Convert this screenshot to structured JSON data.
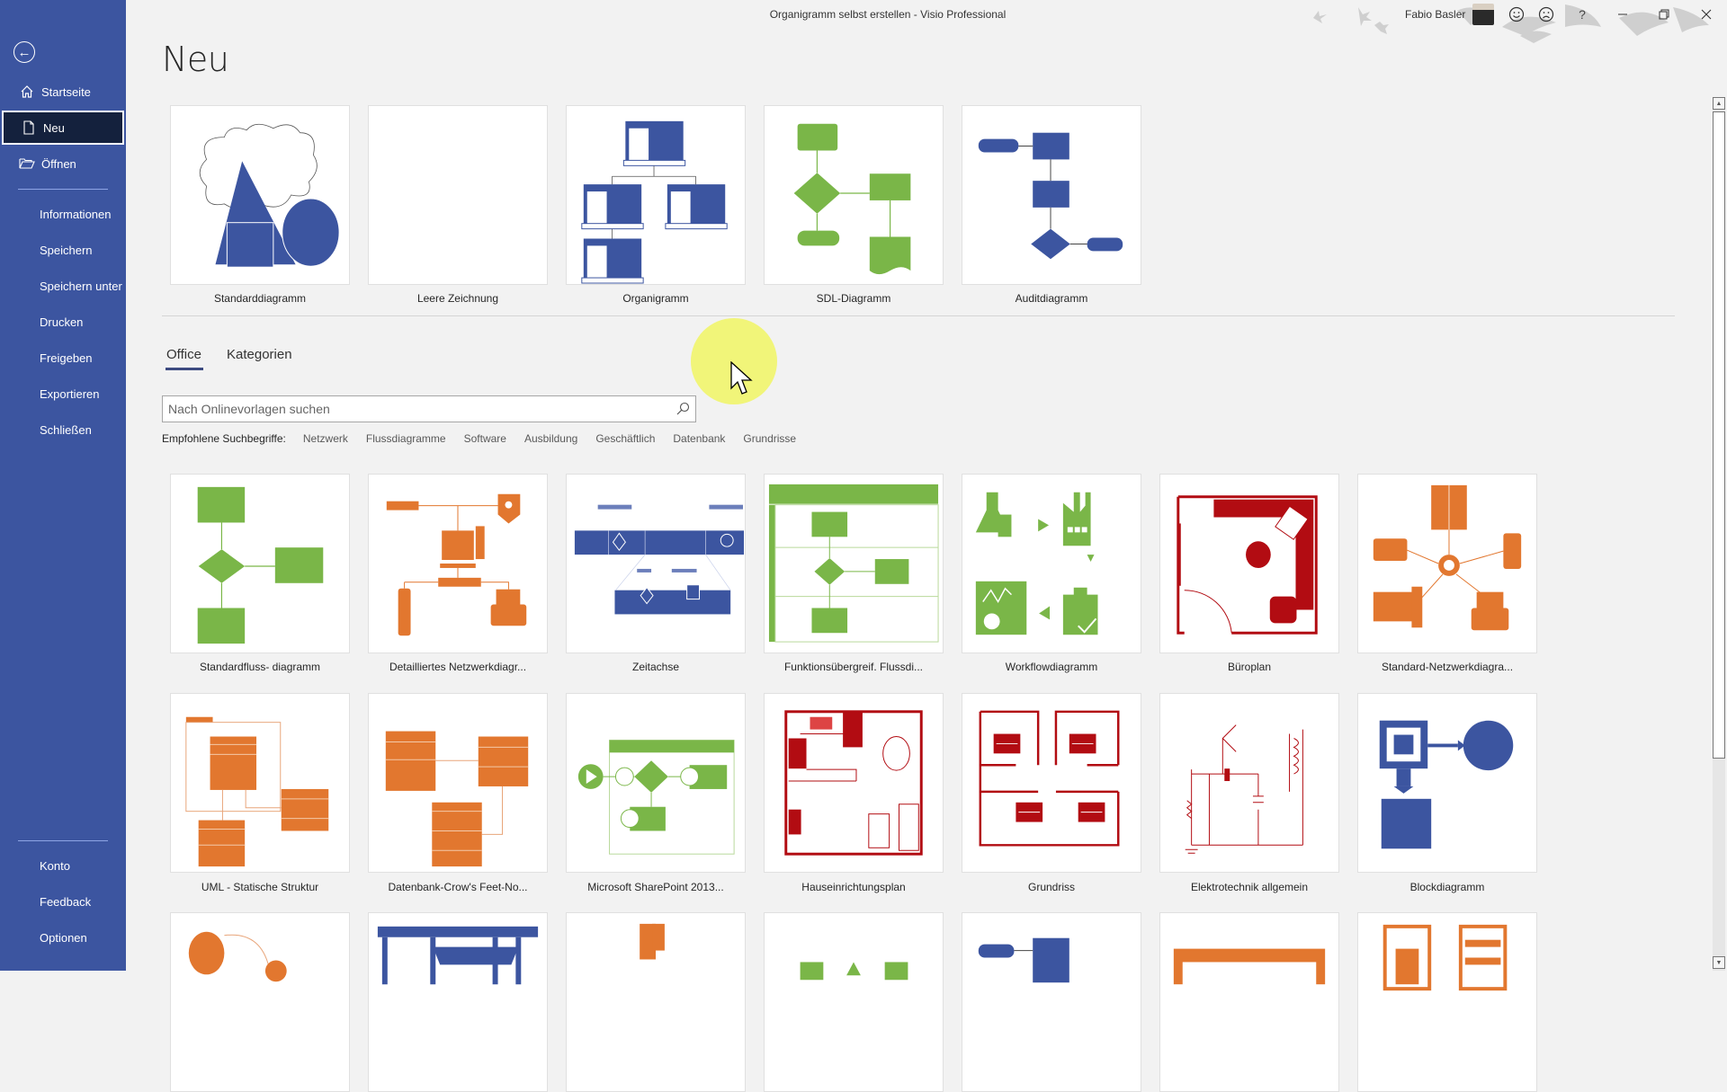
{
  "window": {
    "title": "Organigramm selbst erstellen  -  Visio Professional",
    "user_name": "Fabio Basler",
    "controls": [
      "smile-feedback",
      "frown-feedback",
      "help",
      "minimize",
      "restore",
      "close"
    ],
    "help_label": "?"
  },
  "sidebar": {
    "back_icon": "back-arrow-icon",
    "items_top": [
      {
        "label": "Startseite",
        "icon": "home-icon"
      },
      {
        "label": "Neu",
        "icon": "new-document-icon",
        "active": true
      },
      {
        "label": "Öffnen",
        "icon": "open-folder-icon"
      }
    ],
    "items_mid": [
      {
        "label": "Informationen"
      },
      {
        "label": "Speichern"
      },
      {
        "label": "Speichern unter"
      },
      {
        "label": "Drucken"
      },
      {
        "label": "Freigeben"
      },
      {
        "label": "Exportieren"
      },
      {
        "label": "Schließen"
      }
    ],
    "items_bottom": [
      {
        "label": "Konto"
      },
      {
        "label": "Feedback"
      },
      {
        "label": "Optionen"
      }
    ]
  },
  "main": {
    "page_title": "Neu",
    "featured": [
      {
        "label": "Standarddiagramm"
      },
      {
        "label": "Leere Zeichnung"
      },
      {
        "label": "Organigramm"
      },
      {
        "label": "SDL-Diagramm"
      },
      {
        "label": "Auditdiagramm"
      }
    ],
    "tabs": [
      {
        "label": "Office",
        "active": true
      },
      {
        "label": "Kategorien",
        "active": false
      }
    ],
    "search": {
      "placeholder": "Nach Onlinevorlagen suchen",
      "value": ""
    },
    "suggested_label": "Empfohlene Suchbegriffe:",
    "suggested_terms": [
      "Netzwerk",
      "Flussdiagramme",
      "Software",
      "Ausbildung",
      "Geschäftlich",
      "Datenbank",
      "Grundrisse"
    ],
    "templates_row1": [
      {
        "label": "Standardfluss- diagramm"
      },
      {
        "label": "Detailliertes Netzwerkdiagr..."
      },
      {
        "label": "Zeitachse"
      },
      {
        "label": "Funktionsübergreif. Flussdi..."
      },
      {
        "label": "Workflowdiagramm"
      },
      {
        "label": "Büroplan"
      },
      {
        "label": "Standard-Netzwerkdiagra..."
      }
    ],
    "templates_row2": [
      {
        "label": "UML - Statische Struktur"
      },
      {
        "label": "Datenbank-Crow's Feet-No..."
      },
      {
        "label": "Microsoft SharePoint 2013..."
      },
      {
        "label": "Hauseinrichtungsplan"
      },
      {
        "label": "Grundriss"
      },
      {
        "label": "Elektrotechnik allgemein"
      },
      {
        "label": "Blockdiagramm"
      }
    ]
  },
  "colors": {
    "sidebar": "#3c55a0",
    "sidebar_active": "#14213d",
    "blue": "#3c55a0",
    "green": "#7ab648",
    "orange": "#e2772f",
    "red": "#b20c12"
  }
}
